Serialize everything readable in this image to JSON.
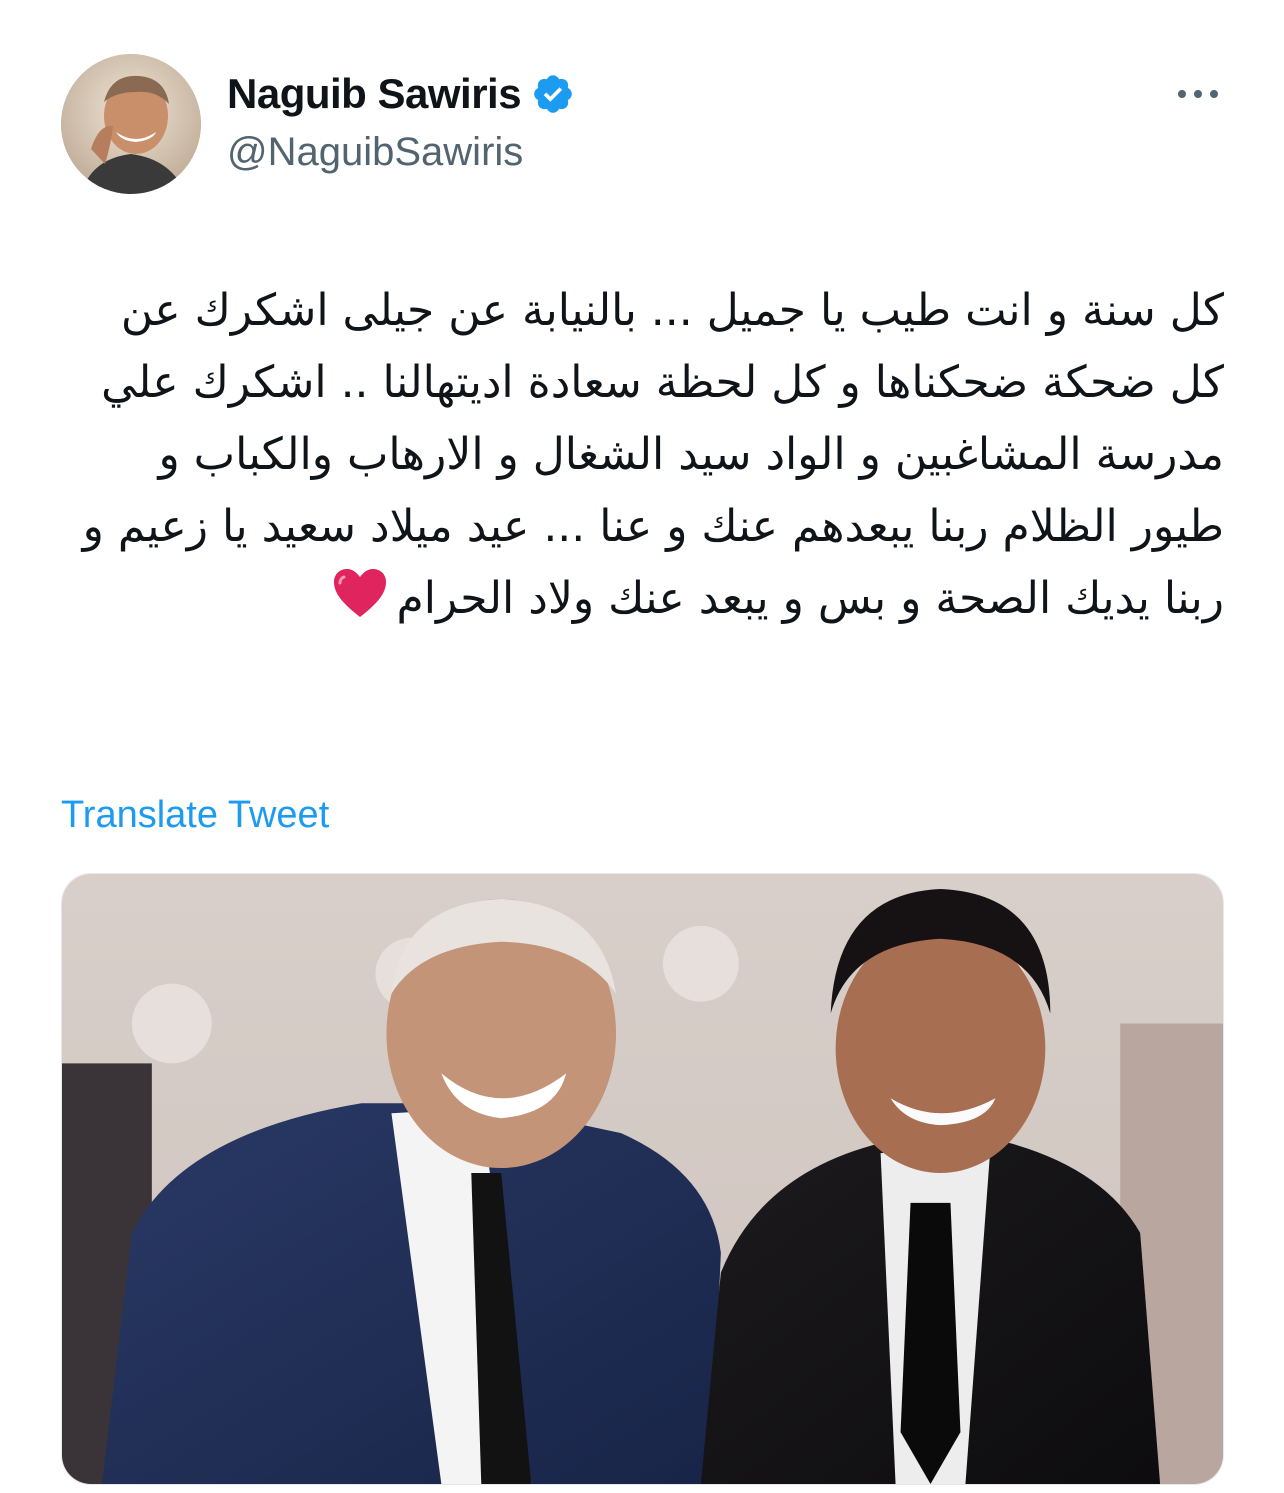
{
  "author": {
    "display_name": "Naguib Sawiris",
    "handle": "@NaguibSawiris",
    "verified": true
  },
  "tweet": {
    "text": "كل سنة و انت طيب يا جميل ... بالنيابة عن جيلى اشكرك عن كل ضحكة ضحكناها و كل لحظة سعادة اديتهالنا .. اشكرك علي مدرسة المشاغبين و الواد سيد الشغال و الارهاب والكباب و طيور الظلام ربنا يبعدهم عنك و عنا ... عيد ميلاد سعيد يا زعيم و ربنا يديك الصحة و بس و يبعد عنك ولاد الحرام",
    "emoji": "heart-icon"
  },
  "actions": {
    "translate_label": "Translate Tweet",
    "more_icon": "more-horizontal-icon"
  },
  "media": {
    "kind": "photo"
  },
  "colors": {
    "text_primary": "#0f1419",
    "text_secondary": "#536471",
    "link": "#1d9bf0",
    "verified": "#1d9bf0",
    "heart": "#e0245e"
  }
}
